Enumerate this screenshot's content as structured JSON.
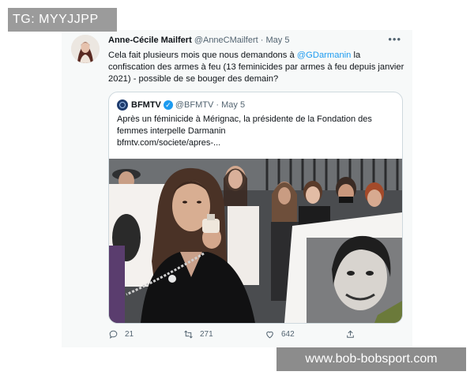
{
  "watermarks": {
    "top": "TG: MYYJJPP",
    "bottom": "www.bob-bobsport.com"
  },
  "tweet": {
    "author_name": "Anne-Cécile Mailfert",
    "author_handle": "@AnneCMailfert",
    "separator": "·",
    "date": "May 5",
    "more_icon": "more-horizontal-icon",
    "text_before_mention": "Cela fait plusieurs mois que nous demandons à ",
    "mention": "@GDarmanin",
    "text_after_mention": " la confiscation des armes à feu (13 feminicides par armes à feu depuis janvier 2021) - possible de se bouger des demain?",
    "quote": {
      "author_name": "BFMTV",
      "author_handle": "@BFMTV",
      "separator": "·",
      "date": "May 5",
      "verified_icon": "verified-badge-icon",
      "text": "Après un féminicide à Mérignac, la présidente de la Fondation des femmes interpelle Darmanin",
      "link": "bfmtv.com/societe/apres-..."
    },
    "actions": {
      "replies": "21",
      "retweets": "271",
      "likes": "642",
      "share_icon": "share-icon"
    }
  },
  "colors": {
    "accent": "#1d9bf0",
    "text": "#0f1419",
    "muted": "#536471",
    "card_bg": "#f7f9f9",
    "border": "#cfd9de"
  }
}
